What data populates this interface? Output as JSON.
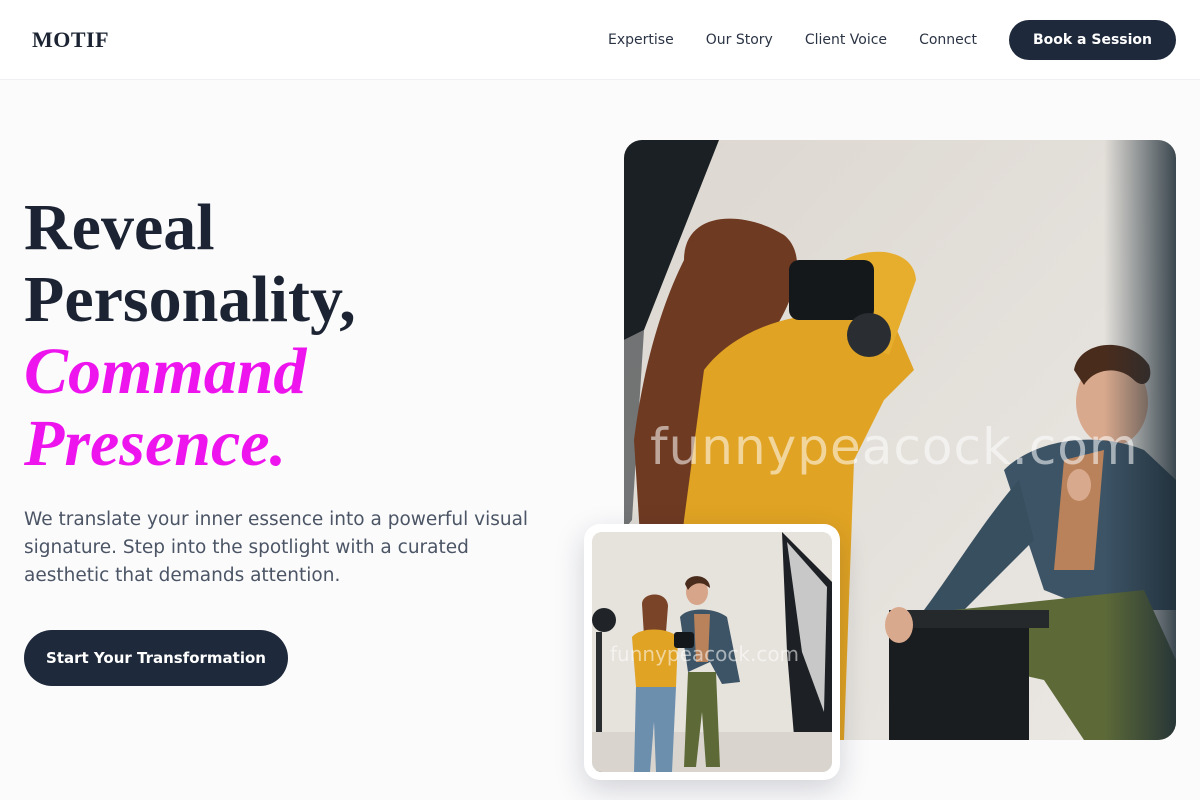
{
  "brand": {
    "logo": "MOTIF"
  },
  "nav": {
    "links": [
      "Expertise",
      "Our Story",
      "Client Voice",
      "Connect"
    ],
    "cta": "Book a Session"
  },
  "hero": {
    "headline_lines": [
      "Reveal",
      "Personality,"
    ],
    "headline_accent_lines": [
      "Command",
      "Presence."
    ],
    "subcopy": "We translate your inner essence into a powerful visual signature. Step into the spotlight with a curated aesthetic that demands attention.",
    "cta": "Start Your Transformation"
  },
  "images": {
    "main_watermark": "funnypeacock.com",
    "inset_watermark": "funnypeacock.com"
  },
  "colors": {
    "accent": "#ee14ee",
    "dark": "#1e293b",
    "background": "#fbfbfc"
  }
}
